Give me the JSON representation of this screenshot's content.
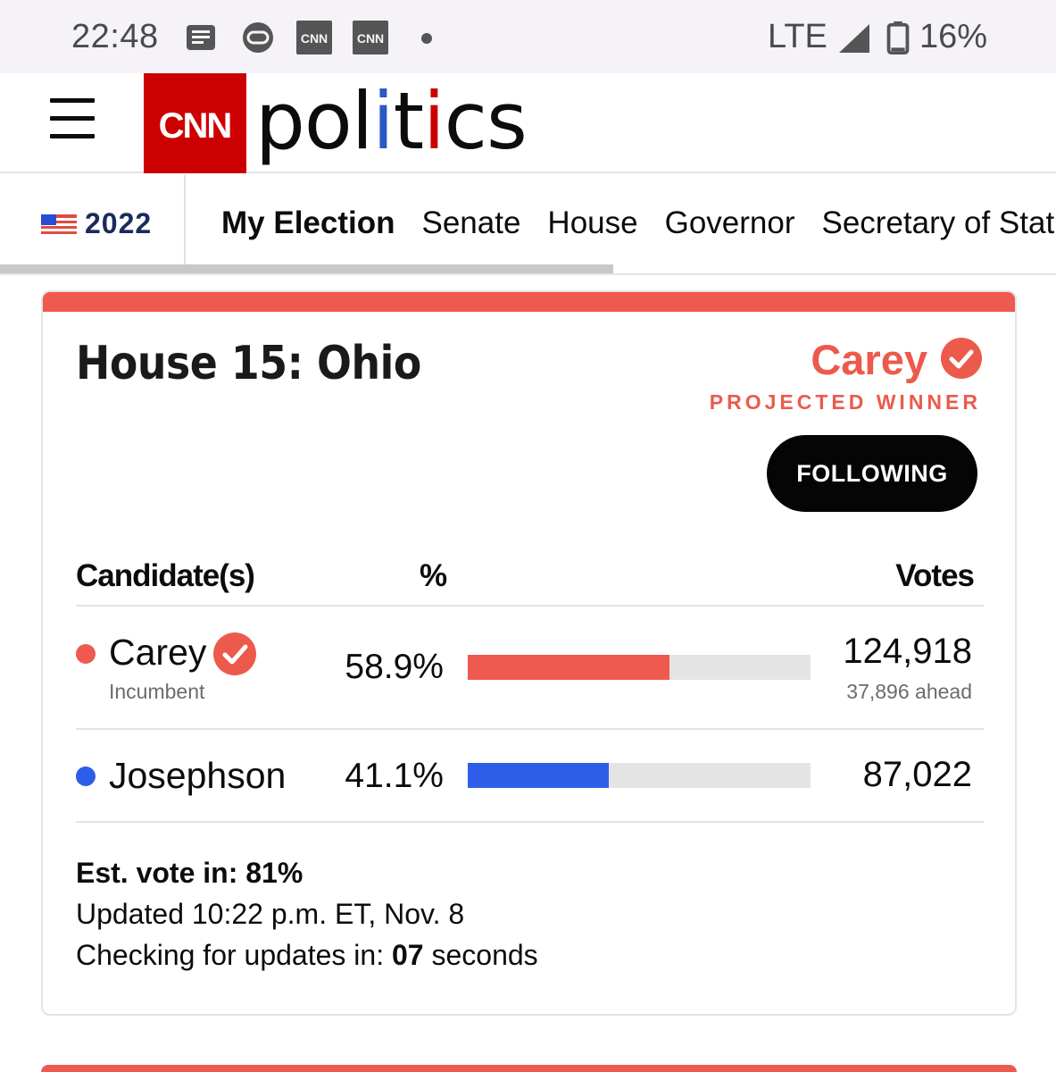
{
  "status_bar": {
    "time": "22:48",
    "notification_icons": [
      "news-icon",
      "app-icon",
      "cnn-icon",
      "cnn-icon"
    ],
    "network": "LTE",
    "battery": "16%"
  },
  "header": {
    "logo_text": "CNN",
    "section_title": "politics"
  },
  "nav": {
    "year": "2022",
    "links": [
      {
        "label": "My Election",
        "active": true
      },
      {
        "label": "Senate",
        "active": false
      },
      {
        "label": "House",
        "active": false
      },
      {
        "label": "Governor",
        "active": false
      },
      {
        "label": "Secretary of Stat",
        "active": false
      }
    ]
  },
  "race": {
    "title": "House 15: Ohio",
    "winner_name": "Carey",
    "winner_label": "PROJECTED WINNER",
    "follow_button": "FOLLOWING",
    "headers": {
      "candidate": "Candidate(s)",
      "percent": "%",
      "votes": "Votes"
    },
    "candidates": [
      {
        "name": "Carey",
        "subtitle": "Incumbent",
        "percent_text": "58.9%",
        "percent": 58.9,
        "votes": "124,918",
        "ahead": "37,896 ahead",
        "winner": true,
        "color": "#ee5a4f"
      },
      {
        "name": "Josephson",
        "subtitle": "",
        "percent_text": "41.1%",
        "percent": 41.1,
        "votes": "87,022",
        "ahead": "",
        "winner": false,
        "color": "#2e5ee8"
      }
    ],
    "est_vote": "Est. vote in: 81%",
    "updated": "Updated 10:22 p.m. ET, Nov. 8",
    "checking_prefix": "Checking for updates in: ",
    "checking_count": "07",
    "checking_suffix": " seconds"
  },
  "colors": {
    "accent_red": "#ec5a4c",
    "party_red": "#ee5a4f",
    "party_blue": "#2e5ee8",
    "cnn_red": "#cc0000"
  }
}
